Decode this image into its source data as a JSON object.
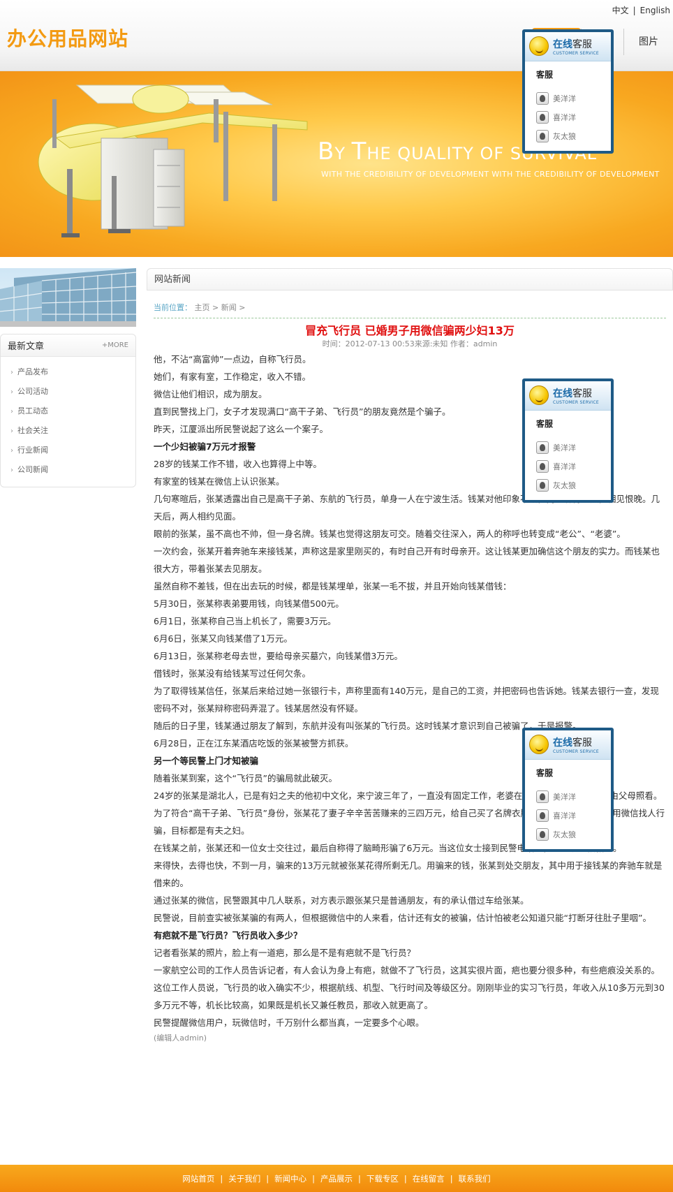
{
  "header": {
    "lang_cn": "中文",
    "lang_sep": "|",
    "lang_en": "English",
    "logo": "办公用品网站",
    "nav": [
      {
        "label": ""
      },
      {
        "label": "图片"
      }
    ]
  },
  "banner": {
    "title_b": "B",
    "title_y": "Y ",
    "title_t": "T",
    "title_rest": "HE QUALITY OF SURVIVAL",
    "subtitle": "WITH THE CREDIBILITY OF DEVELOPMENT WITH THE CREDIBILITY OF DEVELOPMENT"
  },
  "sidebar": {
    "box_title": "最新文章",
    "more": "+MORE",
    "items": [
      "产品发布",
      "公司活动",
      "员工动态",
      "社会关注",
      "行业新闻",
      "公司新闻"
    ]
  },
  "main": {
    "section_title": "网站新闻",
    "crumb_label": "当前位置：",
    "crumb_path": "主页 > 新闻 >",
    "article_title": "冒充飞行员 已婚男子用微信骗两少妇13万",
    "article_meta": "时间：2012-07-13 00:53来源:未知 作者：admin",
    "paragraphs": [
      {
        "t": "他，不沾“高富帅”一点边，自称飞行员。",
        "h": false
      },
      {
        "t": "她们，有家有室，工作稳定，收入不错。",
        "h": false
      },
      {
        "t": "微信让他们相识，成为朋友。",
        "h": false
      },
      {
        "t": "直到民警找上门，女子才发现满口“高干子弟、飞行员”的朋友竟然是个骗子。",
        "h": false
      },
      {
        "t": "昨天，江厦派出所民警说起了这么一个案子。",
        "h": false
      },
      {
        "t": "一个少妇被骗7万元才报警",
        "h": true
      },
      {
        "t": "28岁的钱某工作不错，收入也算得上中等。",
        "h": false
      },
      {
        "t": "有家室的钱某在微信上认识张某。",
        "h": false
      },
      {
        "t": "几句寒暄后，张某透露出自己是高干子弟、东航的飞行员，单身一人在宁波生活。钱某对他印象不错，两人聊得火热，相见恨晚。几天后，两人相约见面。",
        "h": false
      },
      {
        "t": "眼前的张某，虽不高也不帅，但一身名牌。钱某也觉得这朋友可交。随着交往深入，两人的称呼也转变成“老公”、“老婆”。",
        "h": false
      },
      {
        "t": "一次约会，张某开着奔驰车来接钱某，声称这是家里刚买的，有时自己开有时母亲开。这让钱某更加确信这个朋友的实力。而钱某也很大方，带着张某去见朋友。",
        "h": false
      },
      {
        "t": "虽然自称不差钱，但在出去玩的时候，都是钱某埋单，张某一毛不拔，并且开始向钱某借钱：",
        "h": false
      },
      {
        "t": "5月30日，张某称表弟要用钱，向钱某借500元。",
        "h": false
      },
      {
        "t": "6月1日，张某称自己当上机长了，需要3万元。",
        "h": false
      },
      {
        "t": "6月6日，张某又向钱某借了1万元。",
        "h": false
      },
      {
        "t": "6月13日，张某称老母去世，要给母亲买墓穴，向钱某借3万元。",
        "h": false
      },
      {
        "t": "借钱时，张某没有给钱某写过任何欠条。",
        "h": false
      },
      {
        "t": "为了取得钱某信任，张某后来给过她一张银行卡，声称里面有140万元，是自己的工资，并把密码也告诉她。钱某去银行一查，发现密码不对，张某辩称密码弄混了。钱某居然没有怀疑。",
        "h": false
      },
      {
        "t": "随后的日子里，钱某通过朋友了解到，东航并没有叫张某的飞行员。这时钱某才意识到自己被骗了，于是报警。",
        "h": false
      },
      {
        "t": "6月28日，正在江东某酒店吃饭的张某被警方抓获。",
        "h": false
      },
      {
        "t": "另一个等民警上门才知被骗",
        "h": true
      },
      {
        "t": "随着张某到案，这个“飞行员”的骗局就此破灭。",
        "h": false
      },
      {
        "t": "24岁的张某是湖北人，已是有妇之夫的他初中文化，来宁波三年了，一直没有固定工作，老婆在宁波上班，孩子在老家由父母照看。",
        "h": false
      },
      {
        "t": "为了符合“高干子弟、飞行员”身份，张某花了妻子辛辛苦苦赚来的三四万元，给自己买了名牌衣服和一部iPhone4s。他用微信找人行骗，目标都是有夫之妇。",
        "h": false
      },
      {
        "t": "在钱某之前，张某还和一位女士交往过，最后自称得了脑畸形骗了6万元。当这位女士接到民警电话时，才意识到被骗了。",
        "h": false
      },
      {
        "t": "来得快，去得也快，不到一月，骗来的13万元就被张某花得所剩无几。用骗来的钱，张某到处交朋友，其中用于接钱某的奔驰车就是借来的。",
        "h": false
      },
      {
        "t": "通过张某的微信，民警跟其中几人联系，对方表示跟张某只是普通朋友，有的承认借过车给张某。",
        "h": false
      },
      {
        "t": "民警说，目前查实被张某骗的有两人，但根据微信中的人来看，估计还有女的被骗，估计怕被老公知道只能“打断牙往肚子里咽”。",
        "h": false
      },
      {
        "t": "有疤就不是飞行员？飞行员收入多少？",
        "h": true
      },
      {
        "t": "记者看张某的照片，脸上有一道疤，那么是不是有疤就不是飞行员？",
        "h": false
      },
      {
        "t": "一家航空公司的工作人员告诉记者，有人会认为身上有疤，就做不了飞行员，这其实很片面，疤也要分很多种，有些疤痕没关系的。",
        "h": false
      },
      {
        "t": "这位工作人员说，飞行员的收入确实不少，根据航线、机型、飞行时间及等级区分。刚刚毕业的实习飞行员，年收入从10多万元到30多万元不等，机长比较高，如果既是机长又兼任教员，那收入就更高了。",
        "h": false
      },
      {
        "t": "民警提醒微信用户，玩微信时，千万别什么都当真，一定要多个心眼。",
        "h": false
      }
    ],
    "editor": "(编辑人admin)"
  },
  "service": {
    "title_a": "在线",
    "title_b": "客服",
    "title_en": "CUSTOMER SERVICE",
    "caption": "客服",
    "agents": [
      "美洋洋",
      "喜洋洋",
      "灰太狼"
    ]
  },
  "footer": {
    "links": [
      "网站首页",
      "关于我们",
      "新闻中心",
      "产品展示",
      "下载专区",
      "在线留言",
      "联系我们"
    ]
  }
}
